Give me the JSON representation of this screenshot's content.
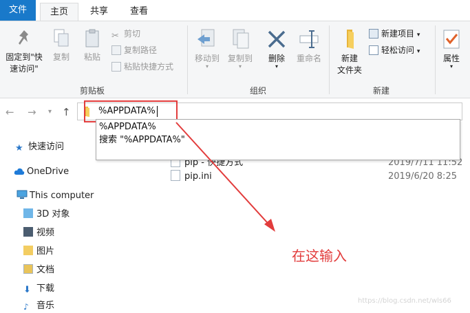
{
  "tabs": {
    "file": "文件",
    "home": "主页",
    "share": "共享",
    "view": "查看"
  },
  "ribbon": {
    "clipboard": {
      "pin_label_1": "固定到\"快",
      "pin_label_2": "速访问\"",
      "copy": "复制",
      "paste": "粘贴",
      "cut": "剪切",
      "copy_path": "复制路径",
      "paste_shortcut": "粘贴快捷方式",
      "group": "剪贴板"
    },
    "organize": {
      "move_to": "移动到",
      "copy_to": "复制到",
      "delete": "删除",
      "rename": "重命名",
      "group": "组织"
    },
    "new": {
      "new_folder_1": "新建",
      "new_folder_2": "文件夹",
      "new_item": "新建项目",
      "easy_access": "轻松访问",
      "group": "新建"
    },
    "open": {
      "properties": "属性"
    }
  },
  "address": {
    "value": "%APPDATA%"
  },
  "dropdown": {
    "items": [
      "%APPDATA%",
      "搜索 \"%APPDATA%\""
    ]
  },
  "sidebar": {
    "quick_access": "快速访问",
    "onedrive": "OneDrive",
    "this_computer": "This computer",
    "children": [
      "3D 对象",
      "视频",
      "图片",
      "文档",
      "下载",
      "音乐"
    ]
  },
  "files": [
    {
      "name": "pip - 快捷方式",
      "date": "2019/7/11 11:52"
    },
    {
      "name": "pip.ini",
      "date": "2019/6/20 8:25"
    }
  ],
  "annotation": "在这输入",
  "watermark": "https://blog.csdn.net/wls66",
  "colors": {
    "accent": "#1979ca",
    "annotation": "#e23c3c",
    "ribbon_bg": "#f5f6f7"
  }
}
